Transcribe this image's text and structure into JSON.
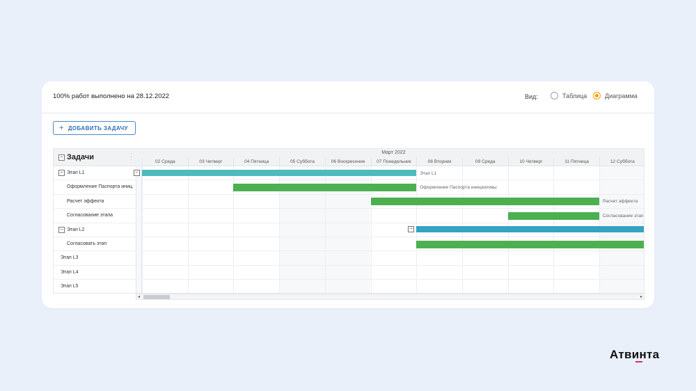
{
  "header": {
    "status": "100% работ выполнено на 28.12.2022",
    "view_label": "Вид:",
    "view_options": [
      {
        "label": "Таблица",
        "selected": false
      },
      {
        "label": "Диаграмма",
        "selected": true
      }
    ]
  },
  "toolbar": {
    "add_task_label": "ДОБАВИТЬ ЗАДАЧУ",
    "add_icon": "plus-icon"
  },
  "tasks_header": "Задачи",
  "tasks": [
    {
      "label": "Этап L1",
      "level": 0,
      "collapsible": true
    },
    {
      "label": "Оформление Паспорта иниц...",
      "level": 1,
      "collapsible": false
    },
    {
      "label": "Расчет эффекта",
      "level": 1,
      "collapsible": false
    },
    {
      "label": "Согласование этапа",
      "level": 1,
      "collapsible": false
    },
    {
      "label": "Этап L2",
      "level": 0,
      "collapsible": true
    },
    {
      "label": "Согласовать этап",
      "level": 1,
      "collapsible": false
    },
    {
      "label": "Этап L3",
      "level": 0,
      "collapsible": false
    },
    {
      "label": "Этап L4",
      "level": 0,
      "collapsible": false
    },
    {
      "label": "Этап L5",
      "level": 0,
      "collapsible": false
    }
  ],
  "timeline": {
    "month": "Март 2022",
    "days": [
      "02 Среда",
      "03 Четверг",
      "04 Пятница",
      "05 Суббота",
      "06 Воскресение",
      "07 Понедельник",
      "08 Вторник",
      "09 Среда",
      "10 Четверг",
      "11 Пятница",
      "12 Суббота"
    ],
    "weekend_days": [
      3,
      4,
      10
    ]
  },
  "bars": [
    {
      "row": 0,
      "start": 0,
      "end": 6,
      "color": "#4dbbbd",
      "label": "Этап L1",
      "summary": true
    },
    {
      "row": 1,
      "start": 2,
      "end": 6,
      "color": "#4caf50",
      "label": "Оформление Паспорта инициативы",
      "summary": false
    },
    {
      "row": 2,
      "start": 5,
      "end": 10,
      "color": "#4caf50",
      "label": "Расчет эффекта",
      "summary": false
    },
    {
      "row": 3,
      "start": 8,
      "end": 10,
      "color": "#4caf50",
      "label": "Согласование этап",
      "summary": false
    },
    {
      "row": 4,
      "start": 6,
      "end": 11,
      "color": "#36a2c4",
      "label": "",
      "summary": true
    },
    {
      "row": 5,
      "start": 6,
      "end": 11,
      "color": "#4caf50",
      "label": "",
      "summary": false
    }
  ],
  "brand": {
    "logo": "Атвинта",
    "accent": "#e0267f"
  }
}
